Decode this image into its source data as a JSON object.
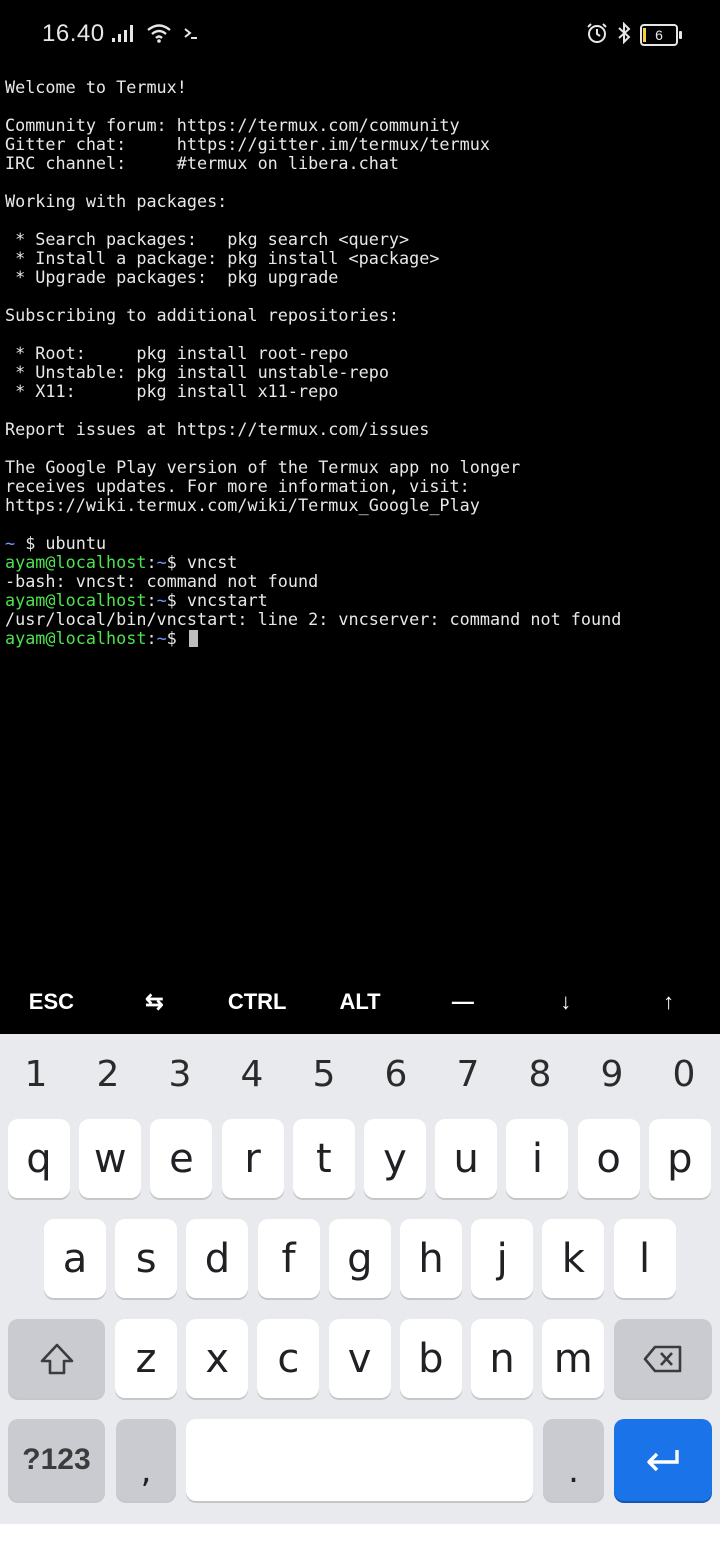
{
  "status_bar": {
    "time": "16.40",
    "battery_level": "6",
    "icons": [
      "signal-icon",
      "wifi-icon",
      "terminal-prompt-icon",
      "alarm-icon",
      "bluetooth-icon",
      "battery-icon"
    ]
  },
  "terminal": {
    "lines": [
      "Welcome to Termux!",
      "",
      "Community forum: https://termux.com/community",
      "Gitter chat:     https://gitter.im/termux/termux",
      "IRC channel:     #termux on libera.chat",
      "",
      "Working with packages:",
      "",
      " * Search packages:   pkg search <query>",
      " * Install a package: pkg install <package>",
      " * Upgrade packages:  pkg upgrade",
      "",
      "Subscribing to additional repositories:",
      "",
      " * Root:     pkg install root-repo",
      " * Unstable: pkg install unstable-repo",
      " * X11:      pkg install x11-repo",
      "",
      "Report issues at https://termux.com/issues",
      "",
      "The Google Play version of the Termux app no longer",
      "receives updates. For more information, visit:",
      "https://wiki.termux.com/wiki/Termux_Google_Play",
      ""
    ],
    "ubuntu_cmd": {
      "prompt": "~",
      "dollar": " $ ",
      "command": "ubuntu"
    },
    "session": [
      {
        "user": "ayam@localhost",
        "colon": ":",
        "path": "~",
        "dollar": "$ ",
        "command": "vncst"
      },
      {
        "output": "-bash: vncst: command not found"
      },
      {
        "user": "ayam@localhost",
        "colon": ":",
        "path": "~",
        "dollar": "$ ",
        "command": "vncstart"
      },
      {
        "output": "/usr/local/bin/vncstart: line 2: vncserver: command not found"
      },
      {
        "user": "ayam@localhost",
        "colon": ":",
        "path": "~",
        "dollar": "$ ",
        "command": ""
      }
    ]
  },
  "extra_keys": [
    {
      "name": "esc-key",
      "label": "ESC"
    },
    {
      "name": "tab-key",
      "label": "⇆"
    },
    {
      "name": "ctrl-key",
      "label": "CTRL"
    },
    {
      "name": "alt-key",
      "label": "ALT"
    },
    {
      "name": "dash-key",
      "label": "—"
    },
    {
      "name": "down-arrow-key",
      "label": "↓"
    },
    {
      "name": "up-arrow-key",
      "label": "↑"
    }
  ],
  "keyboard": {
    "numbers": [
      "1",
      "2",
      "3",
      "4",
      "5",
      "6",
      "7",
      "8",
      "9",
      "0"
    ],
    "row1": [
      "q",
      "w",
      "e",
      "r",
      "t",
      "y",
      "u",
      "i",
      "o",
      "p"
    ],
    "row2": [
      "a",
      "s",
      "d",
      "f",
      "g",
      "h",
      "j",
      "k",
      "l"
    ],
    "row3": [
      "z",
      "x",
      "c",
      "v",
      "b",
      "n",
      "m"
    ],
    "symbols_label": "?123",
    "comma": ",",
    "period": "."
  },
  "colors": {
    "terminal_bg": "#000000",
    "prompt_user": "#4ce34c",
    "prompt_path": "#6f9dff",
    "keyboard_bg": "#e9eaee",
    "enter_key": "#1a73e8"
  }
}
